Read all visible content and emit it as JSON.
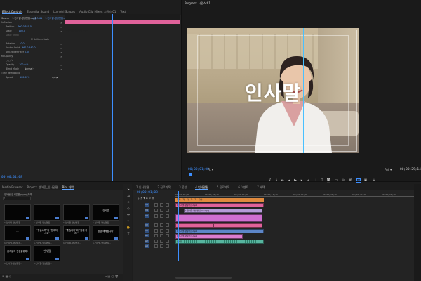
{
  "effect_controls": {
    "tabs": [
      "Effect Controls",
      "Essential Sound",
      "Lumetri Scopes",
      "Audio Clip Mixer: 시퀀스 01",
      "Text"
    ],
    "header_left": "Source • 1.인사말-영상편집.mp4",
    "header_right": "시퀀스 01 • 1.인사말-영상편집.mp4",
    "clip_label": "1.인사말-영상편집.mp4",
    "rows": [
      {
        "label": "fx  Motion",
        "value": ""
      },
      {
        "label": "Position",
        "value": "960.0   540.0"
      },
      {
        "label": "Scale",
        "value": "100.0"
      },
      {
        "label": "Scale Width",
        "value": ""
      },
      {
        "label": "",
        "value": "Uniform Scale"
      },
      {
        "label": "Rotation",
        "value": "0.0"
      },
      {
        "label": "Anchor Point",
        "value": "960.0   540.0"
      },
      {
        "label": "Anti-flicker Filter",
        "value": "0.00"
      },
      {
        "label": "fx  Opacity",
        "value": ""
      },
      {
        "label": "",
        "value": ""
      },
      {
        "label": "Opacity",
        "value": "100.0 %"
      },
      {
        "label": "Blend Mode",
        "value": "Normal"
      },
      {
        "label": "Time Remapping",
        "value": ""
      },
      {
        "label": "Speed",
        "value": "100.00%"
      }
    ],
    "timecode": "00;00;01;08"
  },
  "program_monitor": {
    "tab": "Program: 시퀀스 01",
    "overlay_text": "인사말",
    "timecode_current": "00;00;01;08",
    "timecode_total": "00;00;29;14",
    "fit_label": "Fit",
    "quality_label": "Full",
    "ruler": [
      "00;00;00;00",
      "00;00;14;29",
      "00;00;29;29"
    ]
  },
  "project": {
    "tabs": [
      "Media Browser",
      "Project: 영어문_인사말편",
      "Bin: 자막"
    ],
    "path": "영어문_인사말편.prproj\\자막",
    "items": [
      {
        "title": "",
        "caption": "1.인사말-영상편집..."
      },
      {
        "title": "",
        "caption": "1.인사말-영상편집..."
      },
      {
        "title": "",
        "caption": "1.인사말-영상편집..."
      },
      {
        "title": "인사말",
        "caption": "1.인사말-영상편집..."
      },
      {
        "title": "...",
        "caption": "1.인사말-영상편집..."
      },
      {
        "title": "\"좋습니까\"와 \"함께하세요\"",
        "caption": "1.인사말-영상편집..."
      },
      {
        "title": "\"좋습니까\"와 \"함께 하자!\"",
        "caption": "1.인사말-영상편집..."
      },
      {
        "title": "환영 해제합니다!",
        "caption": "1.인사말-영상편집..."
      },
      {
        "title": "환자분의 건강을위해!",
        "caption": "1.인사말-영상편집..."
      },
      {
        "title": "인사말",
        "caption": "1.인사말-영상편집..."
      }
    ]
  },
  "timeline": {
    "tabs": [
      "1.인사말편",
      "2.진료과목",
      "3.불안",
      "4.인사말편",
      "5.진료과목",
      "6.이벤트",
      "7.혜택"
    ],
    "timecode": "00;00;01;08",
    "ruler": [
      "00;00;00;00",
      "00;00;04;29",
      "00;00;09;29",
      "00;00;14;29",
      "00;00;19;29",
      "00;00;24;29",
      "00;00;29;29",
      "00;00;34;29"
    ],
    "tracks": [
      "V5",
      "V4",
      "V3",
      "V2",
      "V1",
      "A1",
      "A2",
      "A3"
    ],
    "clips": [
      {
        "label": "1.인사말-영상편집.mp4",
        "track": "V5",
        "start": 0.0,
        "end": 0.32
      },
      {
        "label": "1.인사말-영상편집.mp4 [V]",
        "track": "V4",
        "start": 0.04,
        "end": 0.45
      },
      {
        "label": "1.인사말-영상편집.mp4",
        "track": "V1",
        "start": 0.0,
        "end": 0.3
      },
      {
        "label": "1.인사말-영상편집.mp4",
        "track": "V1",
        "start": 0.3,
        "end": 0.6
      },
      {
        "label": "인사말",
        "track": "A1",
        "start": 0.0,
        "end": 0.38
      }
    ]
  },
  "colors": {
    "accent_blue": "#3d8fff",
    "clip_pink": "#e0629a",
    "clip_lavender": "#b59cd8",
    "clip_teal": "#57b59f",
    "clip_orange": "#e08a3e"
  }
}
